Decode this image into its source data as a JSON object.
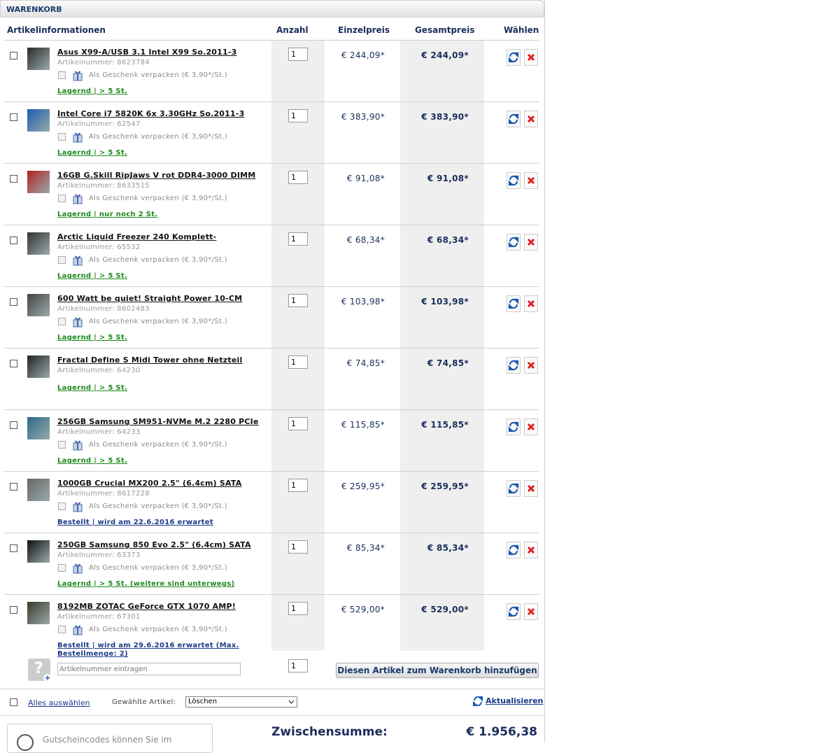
{
  "header": {
    "title": "WARENKORB"
  },
  "columns": {
    "info": "Artikelinformationen",
    "qty": "Anzahl",
    "unit": "Einzelpreis",
    "total": "Gesamtpreis",
    "choose": "Wählen"
  },
  "gift_label": "Als Geschenk verpacken (€ 3,90*/St.)",
  "items": [
    {
      "title": "Asus X99-A/USB 3.1 Intel X99 So.2011-3",
      "artnr": "Artikelnummer: 8623784",
      "gift": true,
      "availability": "Lagernd | > 5 St.",
      "availability_color": "green",
      "qty": "1",
      "unit": "€ 244,09*",
      "total": "€ 244,09*"
    },
    {
      "title": "Intel Core i7 5820K 6x 3.30GHz So.2011-3",
      "artnr": "Artikelnummer: 62547",
      "gift": true,
      "availability": "Lagernd | > 5 St.",
      "availability_color": "green",
      "qty": "1",
      "unit": "€ 383,90*",
      "total": "€ 383,90*"
    },
    {
      "title": "16GB G.Skill RipJaws V rot DDR4-3000 DIMM",
      "artnr": "Artikelnummer: 8633515",
      "gift": true,
      "availability": "Lagernd | nur noch 2 St.",
      "availability_color": "green",
      "qty": "1",
      "unit": "€ 91,08*",
      "total": "€ 91,08*"
    },
    {
      "title": "Arctic Liquid Freezer 240 Komplett-",
      "artnr": "Artikelnummer: 65532",
      "gift": true,
      "availability": "Lagernd | > 5 St.",
      "availability_color": "green",
      "qty": "1",
      "unit": "€ 68,34*",
      "total": "€ 68,34*"
    },
    {
      "title": "600 Watt be quiet! Straight Power 10-CM",
      "artnr": "Artikelnummer: 8602483",
      "gift": true,
      "availability": "Lagernd | > 5 St.",
      "availability_color": "green",
      "qty": "1",
      "unit": "€ 103,98*",
      "total": "€ 103,98*"
    },
    {
      "title": "Fractal Define S Midi Tower ohne Netzteil",
      "artnr": "Artikelnummer: 64230",
      "gift": false,
      "availability": "Lagernd | > 5 St.",
      "availability_color": "green",
      "qty": "1",
      "unit": "€ 74,85*",
      "total": "€ 74,85*"
    },
    {
      "title": "256GB Samsung SM951-NVMe M.2 2280 PCIe",
      "artnr": "Artikelnummer: 64233",
      "gift": true,
      "availability": "Lagernd | > 5 St.",
      "availability_color": "green",
      "qty": "1",
      "unit": "€ 115,85*",
      "total": "€ 115,85*"
    },
    {
      "title": "1000GB Crucial MX200 2.5\" (6.4cm) SATA",
      "artnr": "Artikelnummer: 8617228",
      "gift": true,
      "availability": "Bestellt | wird am 22.6.2016 erwartet",
      "availability_color": "blue",
      "qty": "1",
      "unit": "€ 259,95*",
      "total": "€ 259,95*"
    },
    {
      "title": "250GB Samsung 850 Evo 2.5\" (6.4cm) SATA",
      "artnr": "Artikelnummer: 63373",
      "gift": true,
      "availability": "Lagernd | > 5 St. (weitere sind unterwegs)",
      "availability_color": "green",
      "qty": "1",
      "unit": "€ 85,34*",
      "total": "€ 85,34*"
    },
    {
      "title": "8192MB ZOTAC GeForce GTX 1070 AMP!",
      "artnr": "Artikelnummer: 67301",
      "gift": true,
      "availability": "Bestellt | wird am 29.6.2016 erwartet (Max.",
      "availability2": "Bestellmenge: 2)",
      "availability_color": "blue",
      "qty": "1",
      "unit": "€ 529,00*",
      "total": "€ 529,00*"
    }
  ],
  "add_row": {
    "placeholder": "Artikelnummer eintragen",
    "qty": "1",
    "button": "Diesen Artikel zum Warenkorb hinzufügen"
  },
  "bulk": {
    "select_all": "Alles auswählen",
    "selected_label": "Gewählte Artikel:",
    "action": "Löschen",
    "refresh": "Aktualisieren"
  },
  "footer": {
    "coupon_text": "Gutscheincodes können Sie im",
    "subtotal_label": "Zwischensumme:",
    "subtotal_value": "€ 1.956,38"
  },
  "colors": {
    "header_text": "#1a3a6b",
    "price": "#1a2e5a",
    "in_stock": "#1e8a1e",
    "ordered": "#1a3a8a",
    "delete": "#e02020",
    "refresh": "#1a5ab0"
  }
}
